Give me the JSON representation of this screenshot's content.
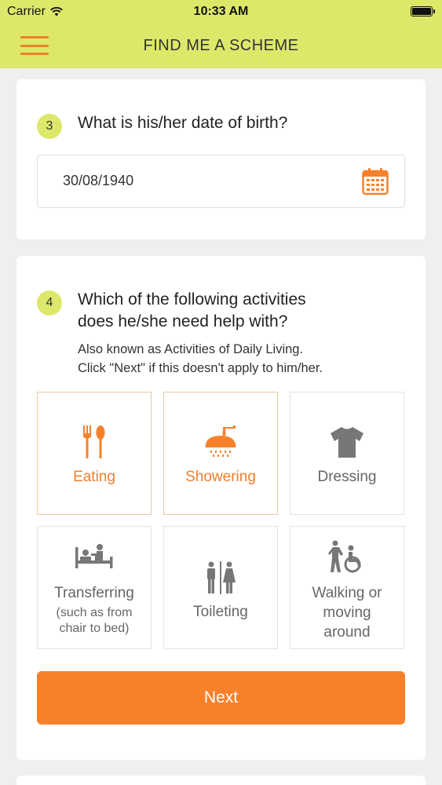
{
  "status_bar": {
    "carrier": "Carrier",
    "time": "10:33 AM"
  },
  "header": {
    "title": "FIND ME A SCHEME",
    "menu_icon": "hamburger-menu-icon"
  },
  "question3": {
    "number": "3",
    "text": "What is his/her date of birth?",
    "date_value": "30/08/1940",
    "calendar_icon": "calendar-icon"
  },
  "question4": {
    "number": "4",
    "line1": "Which of the following activities",
    "line2": "does he/she need help with?",
    "sub1": "Also known as Activities of Daily Living.",
    "sub2": "Click \"Next\" if this doesn't apply to him/her.",
    "activities": [
      {
        "label": "Eating",
        "icon": "fork-spoon-icon",
        "selected": true
      },
      {
        "label": "Showering",
        "icon": "shower-icon",
        "selected": true
      },
      {
        "label": "Dressing",
        "icon": "tshirt-icon",
        "selected": false
      },
      {
        "label": "Transferring",
        "sub1": "(such as from",
        "sub2": "chair to bed)",
        "icon": "bed-icon",
        "selected": false
      },
      {
        "label": "Toileting",
        "icon": "restroom-icon",
        "selected": false
      },
      {
        "label1": "Walking or",
        "label2": "moving",
        "label3": "around",
        "icon": "wheelchair-assist-icon",
        "selected": false
      }
    ],
    "next_label": "Next"
  },
  "colors": {
    "accent": "#f7812a",
    "header_bg": "#dde86a",
    "icon_grey": "#777777"
  }
}
